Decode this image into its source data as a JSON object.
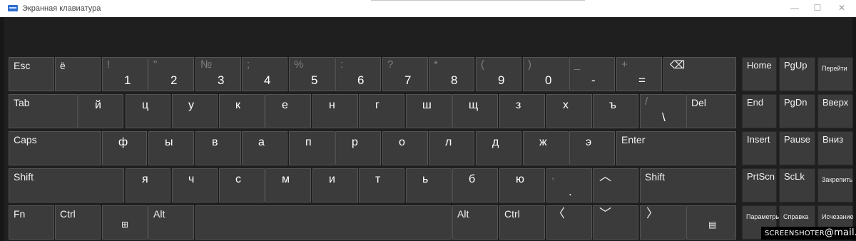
{
  "window": {
    "title": "Экранная клавиатура",
    "minimize": "—",
    "maximize": "☐",
    "close": "✕"
  },
  "rows": [
    [
      {
        "name": "key-esc",
        "label": "Esc"
      },
      {
        "name": "key-yo",
        "label": "ё"
      },
      {
        "name": "key-1",
        "shift": "!",
        "char": "1"
      },
      {
        "name": "key-2",
        "shift": "\"",
        "char": "2"
      },
      {
        "name": "key-3",
        "shift": "№",
        "char": "3"
      },
      {
        "name": "key-4",
        "shift": ";",
        "char": "4"
      },
      {
        "name": "key-5",
        "shift": "%",
        "char": "5"
      },
      {
        "name": "key-6",
        "shift": ":",
        "char": "6"
      },
      {
        "name": "key-7",
        "shift": "?",
        "char": "7"
      },
      {
        "name": "key-8",
        "shift": "*",
        "char": "8"
      },
      {
        "name": "key-9",
        "shift": "(",
        "char": "9"
      },
      {
        "name": "key-0",
        "shift": ")",
        "char": "0"
      },
      {
        "name": "key-minus",
        "shift": "_",
        "char": "-"
      },
      {
        "name": "key-equals",
        "shift": "+",
        "char": "="
      },
      {
        "name": "key-backspace",
        "label": "⌫",
        "icon": "backspace-icon"
      }
    ],
    [
      {
        "name": "key-tab",
        "label": "Tab"
      },
      {
        "name": "key-j",
        "letter": "й"
      },
      {
        "name": "key-ts",
        "letter": "ц"
      },
      {
        "name": "key-u",
        "letter": "у"
      },
      {
        "name": "key-k",
        "letter": "к"
      },
      {
        "name": "key-e",
        "letter": "е"
      },
      {
        "name": "key-n",
        "letter": "н"
      },
      {
        "name": "key-g",
        "letter": "г"
      },
      {
        "name": "key-sh",
        "letter": "ш"
      },
      {
        "name": "key-shch",
        "letter": "щ"
      },
      {
        "name": "key-z",
        "letter": "з"
      },
      {
        "name": "key-h",
        "letter": "х"
      },
      {
        "name": "key-hard-sign",
        "letter": "ъ"
      },
      {
        "name": "key-backslash",
        "shift": "/",
        "char": "\\"
      },
      {
        "name": "key-del",
        "label": "Del"
      }
    ],
    [
      {
        "name": "key-caps",
        "label": "Caps"
      },
      {
        "name": "key-f",
        "letter": "ф"
      },
      {
        "name": "key-y",
        "letter": "ы"
      },
      {
        "name": "key-v",
        "letter": "в"
      },
      {
        "name": "key-a",
        "letter": "а"
      },
      {
        "name": "key-p",
        "letter": "п"
      },
      {
        "name": "key-r",
        "letter": "р"
      },
      {
        "name": "key-o",
        "letter": "о"
      },
      {
        "name": "key-l",
        "letter": "л"
      },
      {
        "name": "key-d",
        "letter": "д"
      },
      {
        "name": "key-zh",
        "letter": "ж"
      },
      {
        "name": "key-eh",
        "letter": "э"
      },
      {
        "name": "key-enter",
        "label": "Enter"
      }
    ],
    [
      {
        "name": "key-shift-left",
        "label": "Shift"
      },
      {
        "name": "key-ya",
        "letter": "я"
      },
      {
        "name": "key-ch",
        "letter": "ч"
      },
      {
        "name": "key-s",
        "letter": "с"
      },
      {
        "name": "key-m",
        "letter": "м"
      },
      {
        "name": "key-i",
        "letter": "и"
      },
      {
        "name": "key-t",
        "letter": "т"
      },
      {
        "name": "key-soft-sign",
        "letter": "ь"
      },
      {
        "name": "key-b",
        "letter": "б"
      },
      {
        "name": "key-yu",
        "letter": "ю"
      },
      {
        "name": "key-period",
        "shift": ",",
        "char": "."
      },
      {
        "name": "key-up",
        "label": "︿",
        "icon": "arrow-up-icon"
      },
      {
        "name": "key-shift-right",
        "label": "Shift"
      }
    ],
    [
      {
        "name": "key-fn",
        "label": "Fn"
      },
      {
        "name": "key-ctrl-left",
        "label": "Ctrl"
      },
      {
        "name": "key-win",
        "label": "⊞",
        "icon": "windows-logo-icon"
      },
      {
        "name": "key-alt-left",
        "label": "Alt"
      },
      {
        "name": "key-space",
        "label": ""
      },
      {
        "name": "key-alt-right",
        "label": "Alt"
      },
      {
        "name": "key-ctrl-right",
        "label": "Ctrl"
      },
      {
        "name": "key-left",
        "label": "〈",
        "icon": "arrow-left-icon"
      },
      {
        "name": "key-down",
        "label": "﹀",
        "icon": "arrow-down-icon"
      },
      {
        "name": "key-right",
        "label": "〉",
        "icon": "arrow-right-icon"
      },
      {
        "name": "key-menu",
        "label": "▤",
        "icon": "menu-icon"
      }
    ]
  ],
  "nav": [
    [
      {
        "name": "key-home",
        "label": "Home"
      },
      {
        "name": "key-pgup",
        "label": "PgUp"
      },
      {
        "name": "key-pereiti",
        "label": "Перейти",
        "small": true
      }
    ],
    [
      {
        "name": "key-end",
        "label": "End"
      },
      {
        "name": "key-pgdn",
        "label": "PgDn"
      },
      {
        "name": "key-vverh",
        "label": "Вверх"
      }
    ],
    [
      {
        "name": "key-insert",
        "label": "Insert"
      },
      {
        "name": "key-pause",
        "label": "Pause"
      },
      {
        "name": "key-vniz",
        "label": "Вниз"
      }
    ],
    [
      {
        "name": "key-prtscn",
        "label": "PrtScn"
      },
      {
        "name": "key-sclk",
        "label": "ScLk"
      },
      {
        "name": "key-zakrepit",
        "label": "Закрепить",
        "small": true
      }
    ],
    [
      {
        "name": "key-parametry",
        "label": "Параметры",
        "small": true
      },
      {
        "name": "key-spravka",
        "label": "Справка",
        "small": true
      },
      {
        "name": "key-ischezanie",
        "label": "Исчезание",
        "small": true
      }
    ]
  ],
  "watermark": {
    "prefix": "SCREENSHOTER",
    "at": "@",
    "suffix": "mail.ru"
  }
}
